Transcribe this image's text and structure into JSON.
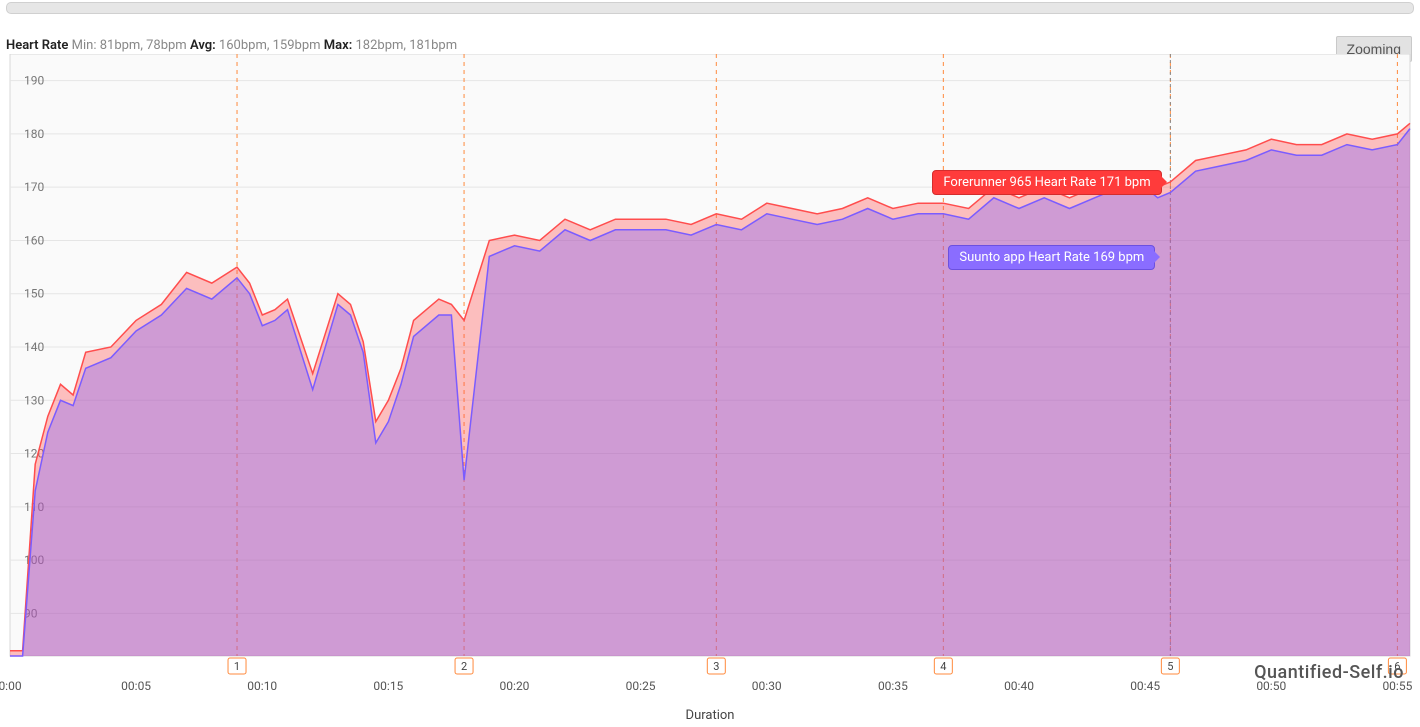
{
  "scrollbar": {
    "present": true
  },
  "stats": {
    "title": "Heart Rate",
    "min_label": "Min:",
    "min_values": "81bpm, 78bpm",
    "avg_label": "Avg:",
    "avg_values": "160bpm, 159bpm",
    "max_label": "Max:",
    "max_values": "182bpm, 181bpm"
  },
  "zoom_button": "Zooming",
  "xlabel": "Duration",
  "watermark": "Quantified-Self.io",
  "tooltips": {
    "forerunner": "Forerunner 965 Heart Rate 171 bpm",
    "suunto": "Suunto app Heart Rate 169 bpm"
  },
  "cursor_time": "00:46",
  "chart_data": {
    "type": "area",
    "title": "Heart Rate",
    "xlabel": "Duration",
    "ylabel": "",
    "yticks": [
      90,
      100,
      110,
      120,
      130,
      140,
      150,
      160,
      170,
      180,
      190
    ],
    "ylim": [
      82,
      195
    ],
    "xticks": [
      "0:00",
      "00:05",
      "00:10",
      "00:15",
      "00:20",
      "00:25",
      "00:30",
      "00:35",
      "00:40",
      "00:45",
      "00:50",
      "00:55"
    ],
    "lap_markers": [
      {
        "label": "1",
        "time": "00:09"
      },
      {
        "label": "2",
        "time": "00:18"
      },
      {
        "label": "3",
        "time": "00:28"
      },
      {
        "label": "4",
        "time": "00:37"
      },
      {
        "label": "5",
        "time": "00:46"
      },
      {
        "label": "6",
        "time": "00:55"
      }
    ],
    "colors": {
      "Forerunner 965": {
        "line": "#ff4d4d",
        "fill": "rgba(255,77,77,0.35)"
      },
      "Suunto app": {
        "line": "#7b5cff",
        "fill": "rgba(123,92,255,0.35)"
      }
    },
    "x": [
      0,
      0.3,
      0.5,
      1,
      1.5,
      2,
      2.5,
      3,
      4,
      5,
      6,
      7,
      8,
      9,
      9.5,
      10,
      10.5,
      11,
      12,
      13,
      13.5,
      14,
      14.5,
      15,
      15.5,
      16,
      17,
      17.5,
      18,
      19,
      20,
      21,
      22,
      23,
      24,
      25,
      26,
      27,
      28,
      29,
      30,
      31,
      32,
      33,
      34,
      35,
      36,
      37,
      38,
      39,
      40,
      41,
      42,
      43,
      44,
      45,
      45.5,
      46,
      47,
      48,
      49,
      50,
      51,
      52,
      53,
      54,
      55,
      55.5
    ],
    "series": [
      {
        "name": "Forerunner 965",
        "values": [
          83,
          83,
          83,
          118,
          127,
          133,
          131,
          139,
          140,
          145,
          148,
          154,
          152,
          155,
          152,
          146,
          147,
          149,
          135,
          150,
          148,
          141,
          126,
          130,
          136,
          145,
          149,
          148,
          145,
          160,
          161,
          160,
          164,
          162,
          164,
          164,
          164,
          163,
          165,
          164,
          167,
          166,
          165,
          166,
          168,
          166,
          167,
          167,
          166,
          170,
          168,
          170,
          168,
          170,
          172,
          172,
          170,
          171,
          175,
          176,
          177,
          179,
          178,
          178,
          180,
          179,
          180,
          182
        ]
      },
      {
        "name": "Suunto app",
        "values": [
          82,
          82,
          82,
          113,
          124,
          130,
          129,
          136,
          138,
          143,
          146,
          151,
          149,
          153,
          150,
          144,
          145,
          147,
          132,
          148,
          146,
          139,
          122,
          126,
          133,
          142,
          146,
          146,
          115,
          157,
          159,
          158,
          162,
          160,
          162,
          162,
          162,
          161,
          163,
          162,
          165,
          164,
          163,
          164,
          166,
          164,
          165,
          165,
          164,
          168,
          166,
          168,
          166,
          168,
          170,
          170,
          168,
          169,
          173,
          174,
          175,
          177,
          176,
          176,
          178,
          177,
          178,
          181
        ]
      }
    ],
    "hover": {
      "x": 46,
      "Forerunner 965": 171,
      "Suunto app": 169
    }
  }
}
